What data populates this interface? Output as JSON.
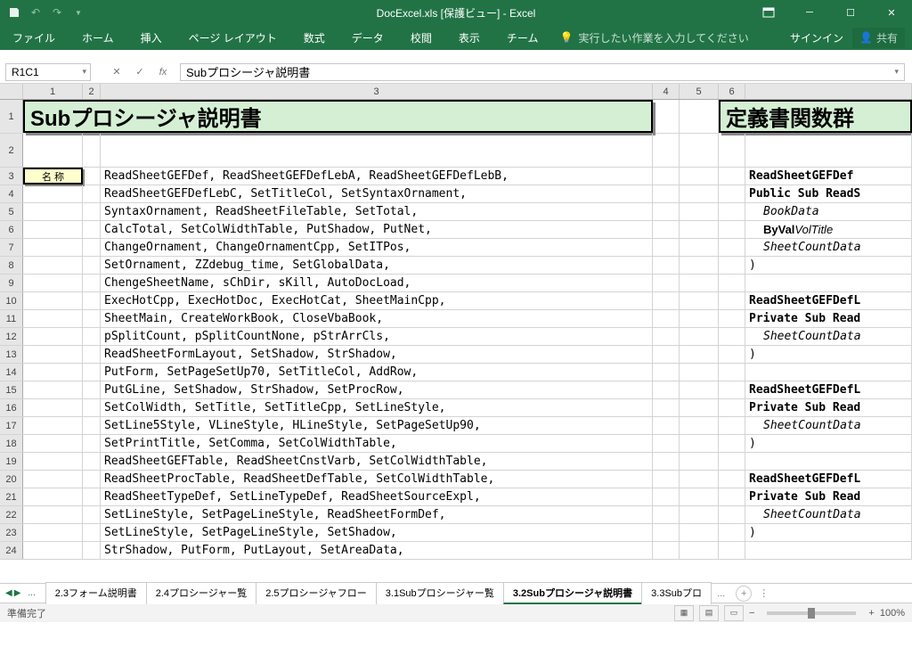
{
  "titlebar": {
    "title": "DocExcel.xls [保護ビュー] - Excel"
  },
  "ribbon": {
    "tabs": [
      "ファイル",
      "ホーム",
      "挿入",
      "ページ レイアウト",
      "数式",
      "データ",
      "校閲",
      "表示",
      "チーム"
    ],
    "tellMe": "実行したい作業を入力してください",
    "signin": "サインイン",
    "share": "共有"
  },
  "formula": {
    "nameBox": "R1C1",
    "value": "Subプロシージャ説明書"
  },
  "columns": [
    "1",
    "2",
    "3",
    "4",
    "5",
    "6"
  ],
  "titles": {
    "left": "Subプロシージャ説明書",
    "right": "定義書関数群"
  },
  "label": "名 称",
  "rows": [
    "ReadSheetGEFDef, ReadSheetGEFDefLebA, ReadSheetGEFDefLebB,",
    "ReadSheetGEFDefLebC, SetTitleCol, SetSyntaxOrnament,",
    "SyntaxOrnament, ReadSheetFileTable, SetTotal,",
    "CalcTotal, SetColWidthTable, PutShadow, PutNet,",
    "ChangeOrnament, ChangeOrnamentCpp, SetITPos,",
    "SetOrnament, ZZdebug_time, SetGlobalData,",
    "ChengeSheetName, sChDir, sKill, AutoDocLoad,",
    "ExecHotCpp, ExecHotDoc, ExecHotCat, SheetMainCpp,",
    "SheetMain, CreateWorkBook, CloseVbaBook,",
    "pSplitCount, pSplitCountNone, pStrArrCls,",
    "ReadSheetFormLayout, SetShadow, StrShadow,",
    "PutForm, SetPageSetUp70, SetTitleCol, AddRow,",
    "PutGLine, SetShadow, StrShadow, SetProcRow,",
    "SetColWidth, SetTitle, SetTitleCpp, SetLineStyle,",
    "SetLine5Style, VLineStyle, HLineStyle, SetPageSetUp90,",
    "SetPrintTitle, SetComma, SetColWidthTable,",
    "ReadSheetGEFTable, ReadSheetCnstVarb, SetColWidthTable,",
    "ReadSheetProcTable, ReadSheetDefTable, SetColWidthTable,",
    "ReadSheetTypeDef, SetLineTypeDef, ReadSheetSourceExpl,",
    "SetLineStyle, SetPageLineStyle, ReadSheetFormDef,",
    "SetLineStyle, SetPageLineStyle, SetShadow,",
    "StrShadow, PutForm, PutLayout, SetAreaData,"
  ],
  "right": [
    {
      "r": 3,
      "t": "ReadSheetGEFDef",
      "cls": "bold"
    },
    {
      "r": 4,
      "t": "Public Sub ReadS",
      "cls": "bold"
    },
    {
      "r": 5,
      "t": "BookData",
      "cls": "ital indent"
    },
    {
      "r": 6,
      "t": "ByVal VolTitle",
      "cls": "indent",
      "mix": true
    },
    {
      "r": 7,
      "t": "SheetCountData",
      "cls": "ital indent"
    },
    {
      "r": 8,
      "t": ")",
      "cls": ""
    },
    {
      "r": 10,
      "t": "ReadSheetGEFDefL",
      "cls": "bold"
    },
    {
      "r": 11,
      "t": "Private Sub Read",
      "cls": "bold"
    },
    {
      "r": 12,
      "t": "SheetCountData",
      "cls": "ital indent"
    },
    {
      "r": 13,
      "t": ")",
      "cls": ""
    },
    {
      "r": 15,
      "t": "ReadSheetGEFDefL",
      "cls": "bold"
    },
    {
      "r": 16,
      "t": "Private Sub Read",
      "cls": "bold"
    },
    {
      "r": 17,
      "t": "SheetCountData",
      "cls": "ital indent"
    },
    {
      "r": 18,
      "t": ")",
      "cls": ""
    },
    {
      "r": 20,
      "t": "ReadSheetGEFDefL",
      "cls": "bold"
    },
    {
      "r": 21,
      "t": "Private Sub Read",
      "cls": "bold"
    },
    {
      "r": 22,
      "t": "SheetCountData",
      "cls": "ital indent"
    },
    {
      "r": 23,
      "t": ")",
      "cls": ""
    }
  ],
  "sheetTabs": [
    "2.3フォーム説明書",
    "2.4プロシージャー覧",
    "2.5プロシージャフロー",
    "3.1Subプロシージャー覧",
    "3.2Subプロシージャ説明書",
    "3.3Subプロ"
  ],
  "activeTab": 4,
  "status": {
    "ready": "準備完了",
    "zoom": "100%"
  }
}
